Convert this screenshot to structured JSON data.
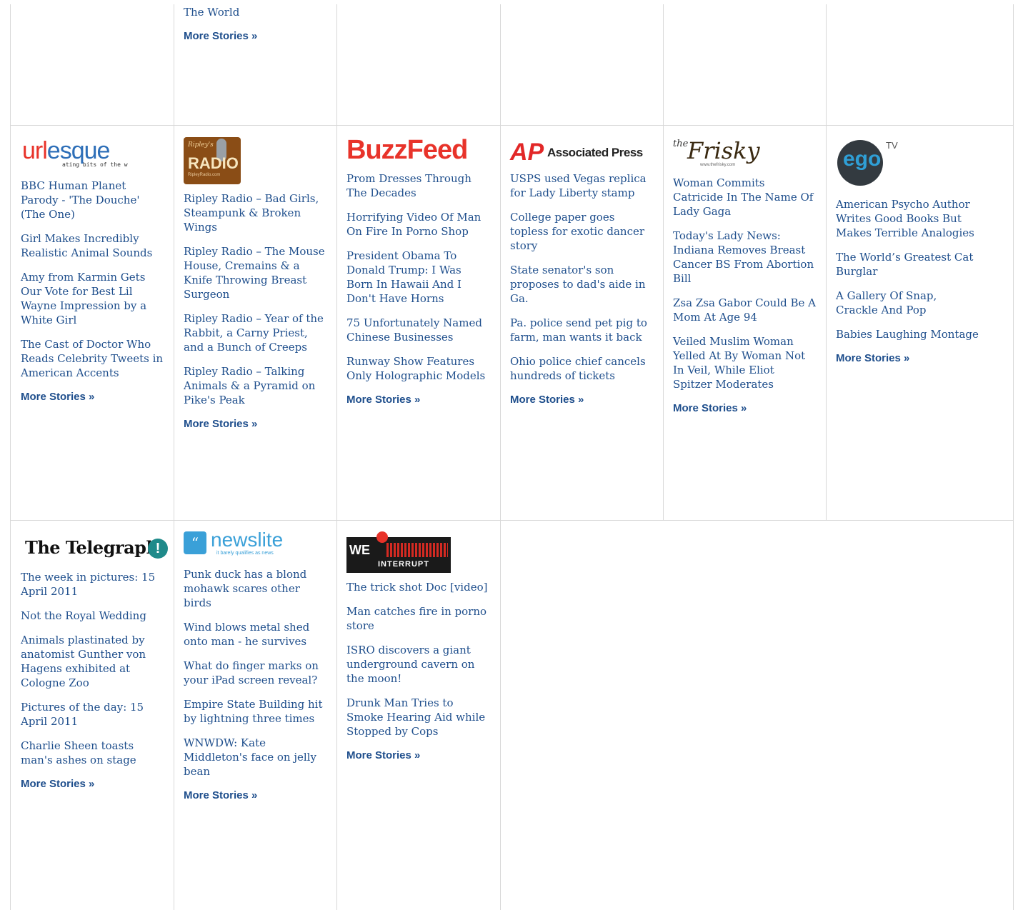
{
  "more_label": "More Stories »",
  "row1": {
    "col2": {
      "partial_story": "The World"
    }
  },
  "row2": [
    {
      "source": "urlesque",
      "logo": {
        "word": "urlesque",
        "tagline": "ating bits of the w"
      },
      "stories": [
        "BBC Human Planet Parody - 'The Douche' (The One)",
        "Girl Makes Incredibly Realistic Animal Sounds",
        "Amy from Karmin Gets Our Vote for Best Lil Wayne Impression by a White Girl",
        "The Cast of Doctor Who Reads Celebrity Tweets in American Accents"
      ]
    },
    {
      "source": "ripley-radio",
      "logo": {
        "top": "Ripley's",
        "word": "RADIO",
        "bottom": "RipleyRadio.com"
      },
      "stories": [
        "Ripley Radio – Bad Girls, Steampunk & Broken Wings",
        "Ripley Radio – The Mouse House, Cremains & a Knife Throwing Breast Surgeon",
        "Ripley Radio – Year of the Rabbit, a Carny Priest, and a Bunch of Creeps",
        "Ripley Radio – Talking Animals & a Pyramid on Pike's Peak"
      ]
    },
    {
      "source": "buzzfeed",
      "logo": {
        "word": "BuzzFeed"
      },
      "stories": [
        "Prom Dresses Through The Decades",
        "Horrifying Video Of Man On Fire In Porno Shop",
        "President Obama To Donald Trump: I Was Born In Hawaii And I Don't Have Horns",
        "75 Unfortunately Named Chinese Businesses",
        "Runway Show Features Only Holographic Models"
      ]
    },
    {
      "source": "associated-press",
      "logo": {
        "mark": "AP",
        "word": "Associated Press"
      },
      "stories": [
        "USPS used Vegas replica for Lady Liberty stamp",
        "College paper goes topless for exotic dancer story",
        "State senator's son proposes to dad's aide in Ga.",
        "Pa. police send pet pig to farm, man wants it back",
        "Ohio police chief cancels hundreds of tickets"
      ]
    },
    {
      "source": "the-frisky",
      "logo": {
        "the": "the",
        "word": "Frisky",
        "url": "www.thefrisky.com"
      },
      "stories": [
        "Woman Commits Catricide In The Name Of Lady Gaga",
        "Today's Lady News: Indiana Removes Breast Cancer BS From Abortion Bill",
        "Zsa Zsa Gabor Could Be A Mom At Age 94",
        "Veiled Muslim Woman Yelled At By Woman Not In Veil, While Eliot Spitzer Moderates"
      ]
    },
    {
      "source": "ego-tv",
      "logo": {
        "word": "ego",
        "suffix": "TV"
      },
      "stories": [
        "American Psycho Author Writes Good Books But Makes Terrible Analogies",
        "The World’s Greatest Cat Burglar",
        "A Gallery Of Snap, Crackle And Pop",
        "Babies Laughing Montage"
      ]
    }
  ],
  "row3": [
    {
      "source": "the-telegraph",
      "logo": {
        "word": "The Telegraph",
        "badge": "!"
      },
      "stories": [
        "The week in pictures: 15 April 2011",
        "Not the Royal Wedding",
        "Animals plastinated by anatomist Gunther von Hagens exhibited at Cologne Zoo",
        "Pictures of the day: 15 April 2011",
        "Charlie Sheen toasts man's ashes on stage"
      ]
    },
    {
      "source": "newslite",
      "logo": {
        "word": "newslite",
        "tagline": "it barely qualifies as news"
      },
      "stories": [
        "Punk duck has a blond mohawk scares other birds",
        "Wind blows metal shed onto man - he survives",
        "What do finger marks on your iPad screen reveal?",
        "Empire State Building hit by lightning three times",
        "WNWDW: Kate Middleton's face on jelly bean"
      ]
    },
    {
      "source": "we-interrupt",
      "logo": {
        "we": "WE",
        "word": "INTERRUPT"
      },
      "stories": [
        "The trick shot Doc [video]",
        "Man catches fire in porno store",
        "ISRO discovers a giant underground cavern on the moon!",
        "Drunk Man Tries to Smoke Hearing Aid while Stopped by Cops"
      ]
    }
  ],
  "colors": {
    "link": "#1e4e8c",
    "grid": "#d8d8d8",
    "buzzfeed": "#e8332a",
    "ap": "#e22727"
  }
}
